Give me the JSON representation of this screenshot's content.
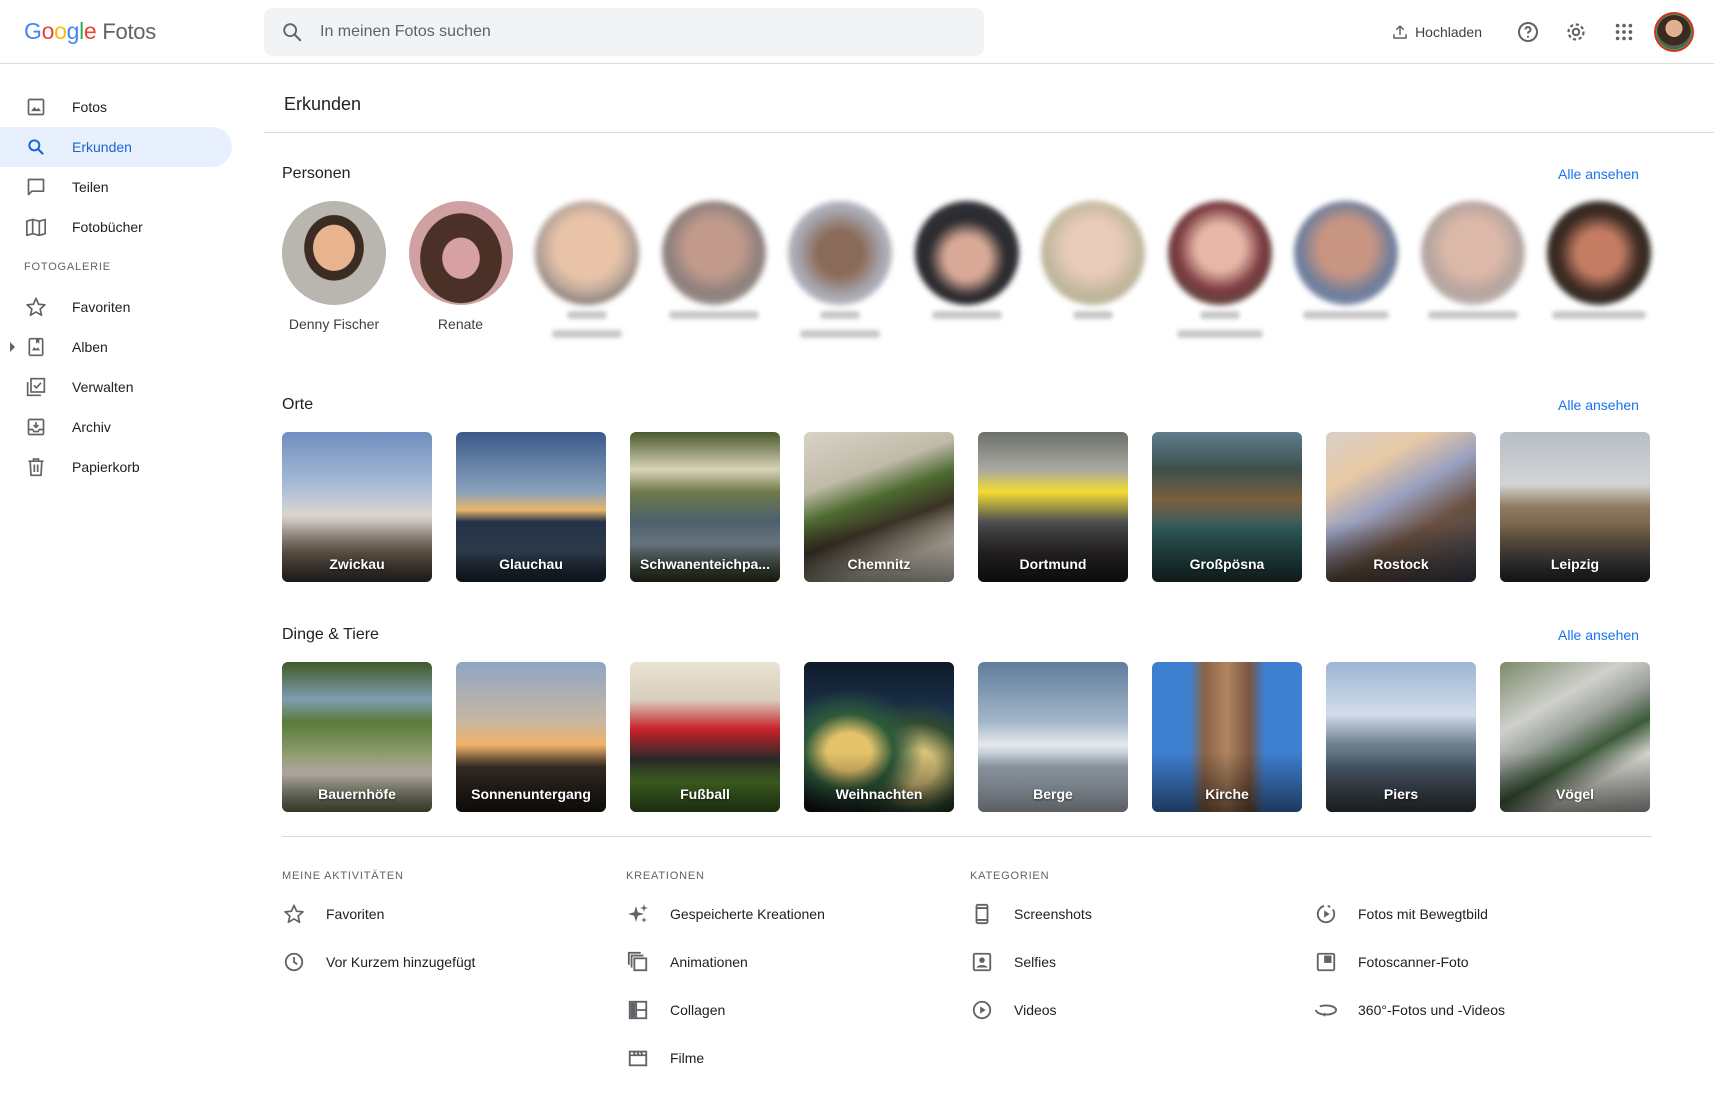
{
  "header": {
    "logo_google": "Google",
    "logo_product": "Fotos",
    "search_placeholder": "In meinen Fotos suchen",
    "upload_label": "Hochladen"
  },
  "sidebar": {
    "items": [
      {
        "label": "Fotos",
        "icon": "photo-icon"
      },
      {
        "label": "Erkunden",
        "icon": "search-icon",
        "active": true
      },
      {
        "label": "Teilen",
        "icon": "chat-icon"
      },
      {
        "label": "Fotobücher",
        "icon": "book-icon"
      }
    ],
    "section_label": "FOTOGALERIE",
    "library": [
      {
        "label": "Favoriten",
        "icon": "star-icon"
      },
      {
        "label": "Alben",
        "icon": "album-icon"
      },
      {
        "label": "Verwalten",
        "icon": "checkbox-icon"
      },
      {
        "label": "Archiv",
        "icon": "archive-icon"
      },
      {
        "label": "Papierkorb",
        "icon": "trash-icon"
      }
    ]
  },
  "main": {
    "title": "Erkunden",
    "see_all": "Alle ansehen",
    "people_title": "Personen",
    "people": [
      {
        "name": "Denny Fischer"
      },
      {
        "name": "Renate"
      },
      {
        "name": "",
        "blurred": true
      },
      {
        "name": "",
        "blurred": true
      },
      {
        "name": "",
        "blurred": true
      },
      {
        "name": "",
        "blurred": true
      },
      {
        "name": "",
        "blurred": true
      },
      {
        "name": "",
        "blurred": true
      },
      {
        "name": "",
        "blurred": true
      },
      {
        "name": "",
        "blurred": true
      },
      {
        "name": "",
        "blurred": true
      }
    ],
    "places_title": "Orte",
    "places": [
      "Zwickau",
      "Glauchau",
      "Schwanenteichpa...",
      "Chemnitz",
      "Dortmund",
      "Großpösna",
      "Rostock",
      "Leipzig"
    ],
    "things_title": "Dinge & Tiere",
    "things": [
      "Bauernhöfe",
      "Sonnenuntergang",
      "Fußball",
      "Weihnachten",
      "Berge",
      "Kirche",
      "Piers",
      "Vögel"
    ]
  },
  "bottom": {
    "activities": {
      "heading": "MEINE AKTIVITÄTEN",
      "items": [
        "Favoriten",
        "Vor Kurzem hinzugefügt"
      ]
    },
    "creations": {
      "heading": "KREATIONEN",
      "items": [
        "Gespeicherte Kreationen",
        "Animationen",
        "Collagen",
        "Filme"
      ]
    },
    "categories": {
      "heading": "KATEGORIEN",
      "left": [
        "Screenshots",
        "Selfies",
        "Videos"
      ],
      "right": [
        "Fotos mit Bewegtbild",
        "Fotoscanner-Foto",
        "360°-Fotos und -Videos"
      ]
    }
  },
  "colors": {
    "accent": "#1a73e8",
    "active_bg": "#e8f0fe",
    "active_text": "#1967d2"
  }
}
